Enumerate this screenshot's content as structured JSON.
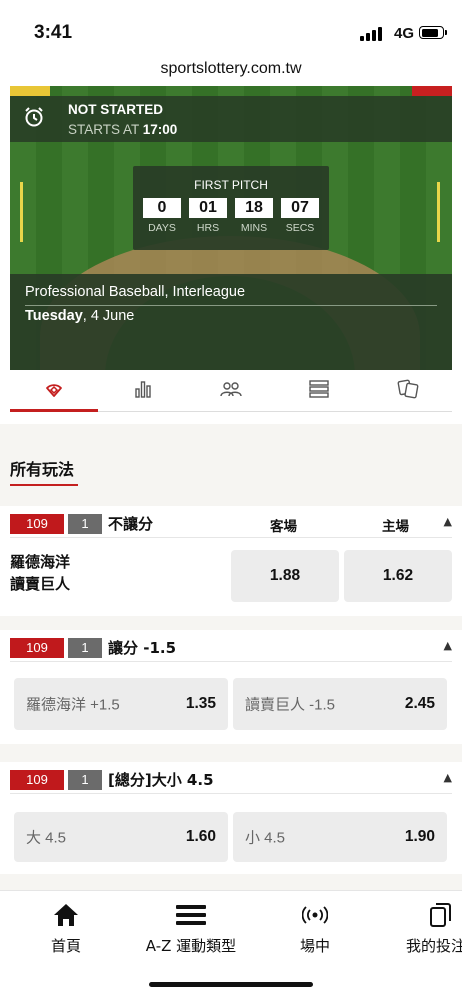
{
  "status_bar": {
    "time": "3:41",
    "network": "4G"
  },
  "browser": {
    "url": "sportslottery.com.tw"
  },
  "match": {
    "status": "NOT STARTED",
    "starts_prefix": "STARTS AT ",
    "start_time": "17:00",
    "countdown_title": "FIRST PITCH",
    "countdown": [
      {
        "value": "0",
        "unit": "DAYS"
      },
      {
        "value": "01",
        "unit": "HRS"
      },
      {
        "value": "18",
        "unit": "MINS"
      },
      {
        "value": "07",
        "unit": "SECS"
      }
    ],
    "league": "Professional Baseball, Interleague",
    "day": "Tuesday",
    "date_rest": ", 4 June"
  },
  "tabs": [
    {
      "icon": "baseball-field-icon",
      "active": true
    },
    {
      "icon": "stats-chart-icon",
      "active": false
    },
    {
      "icon": "lineup-icon",
      "active": false
    },
    {
      "icon": "list-icon",
      "active": false
    },
    {
      "icon": "cards-icon",
      "active": false
    }
  ],
  "section_title": "所有玩法",
  "markets": [
    {
      "code": "109",
      "num": "1",
      "title": "不讓分",
      "col_away": "客場",
      "col_home": "主場",
      "team1": "羅德海洋",
      "team2": "讀賣巨人",
      "odds": [
        {
          "label": "",
          "value": "1.88"
        },
        {
          "label": "",
          "value": "1.62"
        }
      ]
    },
    {
      "code": "109",
      "num": "1",
      "title": "讓分 -1.5",
      "odds": [
        {
          "label": "羅德海洋 +1.5",
          "value": "1.35"
        },
        {
          "label": "讀賣巨人 -1.5",
          "value": "2.45"
        }
      ]
    },
    {
      "code": "109",
      "num": "1",
      "title": "[總分]大小 4.5",
      "odds": [
        {
          "label": "大 4.5",
          "value": "1.60"
        },
        {
          "label": "小 4.5",
          "value": "1.90"
        }
      ]
    }
  ],
  "bottom_nav": [
    {
      "label": "首頁",
      "icon": "home-icon"
    },
    {
      "label": "A-Z 運動類型",
      "icon": "menu-icon"
    },
    {
      "label": "場中",
      "icon": "live-icon"
    },
    {
      "label": "我的投注",
      "icon": "bets-icon"
    }
  ]
}
